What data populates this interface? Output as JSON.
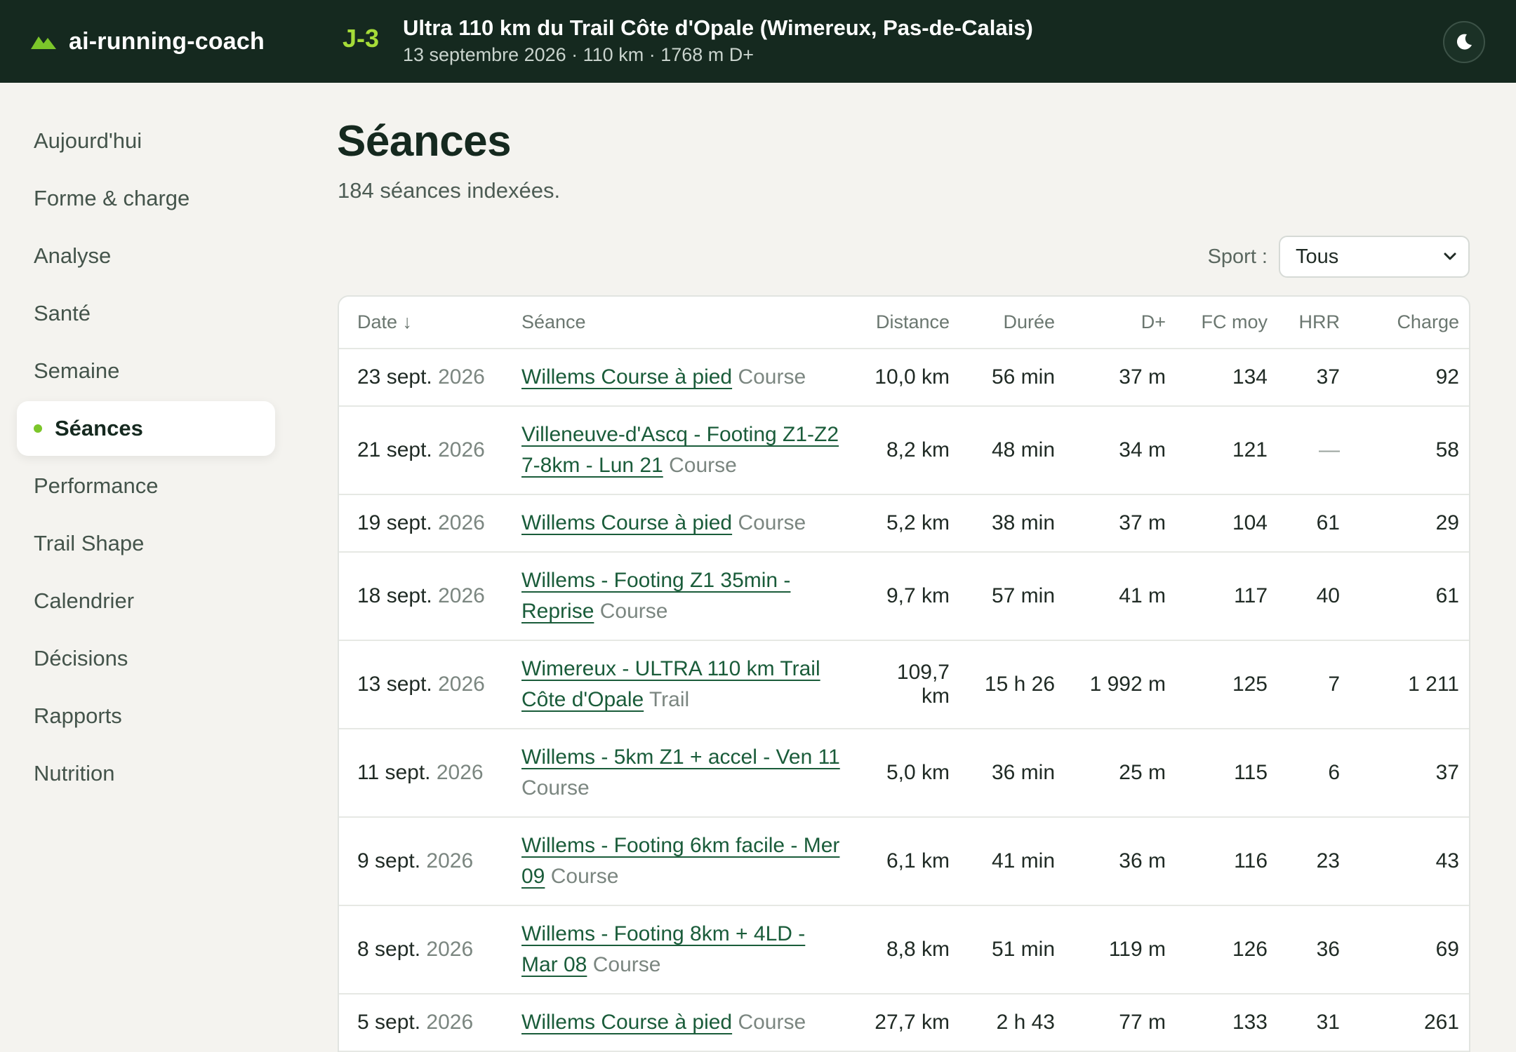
{
  "header": {
    "app_name": "ai-running-coach",
    "countdown": "J-3",
    "race_title": "Ultra 110 km du Trail Côte d'Opale (Wimereux, Pas-de-Calais)",
    "race_meta": "13 septembre 2026 · 110 km · 1768 m D+",
    "theme_icon": "moon-icon"
  },
  "sidebar": {
    "items": [
      {
        "label": "Aujourd'hui"
      },
      {
        "label": "Forme & charge"
      },
      {
        "label": "Analyse"
      },
      {
        "label": "Santé"
      },
      {
        "label": "Semaine"
      },
      {
        "label": "Séances",
        "active": true
      },
      {
        "label": "Performance"
      },
      {
        "label": "Trail Shape"
      },
      {
        "label": "Calendrier"
      },
      {
        "label": "Décisions"
      },
      {
        "label": "Rapports"
      },
      {
        "label": "Nutrition"
      }
    ]
  },
  "main": {
    "title": "Séances",
    "subtitle": "184 séances indexées.",
    "filter_label": "Sport :",
    "filter_value": "Tous"
  },
  "table": {
    "columns": [
      "Date ↓",
      "Séance",
      "Distance",
      "Durée",
      "D+",
      "FC moy",
      "HRR",
      "Charge"
    ],
    "rows": [
      {
        "day": "23 sept.",
        "year": "2026",
        "name": "Willems Course à pied",
        "type": "Course",
        "distance": "10,0 km",
        "duration": "56 min",
        "dplus": "37 m",
        "hr": "134",
        "hrr": "37",
        "load": "92"
      },
      {
        "day": "21 sept.",
        "year": "2026",
        "name": "Villeneuve-d'Ascq - Footing Z1-Z2 7-8km - Lun 21",
        "type": "Course",
        "distance": "8,2 km",
        "duration": "48 min",
        "dplus": "34 m",
        "hr": "121",
        "hrr": "—",
        "load": "58"
      },
      {
        "day": "19 sept.",
        "year": "2026",
        "name": "Willems Course à pied",
        "type": "Course",
        "distance": "5,2 km",
        "duration": "38 min",
        "dplus": "37 m",
        "hr": "104",
        "hrr": "61",
        "load": "29"
      },
      {
        "day": "18 sept.",
        "year": "2026",
        "name": "Willems - Footing Z1 35min - Reprise",
        "type": "Course",
        "distance": "9,7 km",
        "duration": "57 min",
        "dplus": "41 m",
        "hr": "117",
        "hrr": "40",
        "load": "61"
      },
      {
        "day": "13 sept.",
        "year": "2026",
        "name": "Wimereux - ULTRA 110 km Trail Côte d'Opale",
        "type": "Trail",
        "distance": "109,7 km",
        "duration": "15 h 26",
        "dplus": "1 992 m",
        "hr": "125",
        "hrr": "7",
        "load": "1 211"
      },
      {
        "day": "11 sept.",
        "year": "2026",
        "name": "Willems - 5km Z1 + accel - Ven 11",
        "type": "Course",
        "distance": "5,0 km",
        "duration": "36 min",
        "dplus": "25 m",
        "hr": "115",
        "hrr": "6",
        "load": "37"
      },
      {
        "day": "9 sept.",
        "year": "2026",
        "name": "Willems - Footing 6km facile - Mer 09",
        "type": "Course",
        "distance": "6,1 km",
        "duration": "41 min",
        "dplus": "36 m",
        "hr": "116",
        "hrr": "23",
        "load": "43"
      },
      {
        "day": "8 sept.",
        "year": "2026",
        "name": "Willems - Footing 8km + 4LD - Mar 08",
        "type": "Course",
        "distance": "8,8 km",
        "duration": "51 min",
        "dplus": "119 m",
        "hr": "126",
        "hrr": "36",
        "load": "69"
      },
      {
        "day": "5 sept.",
        "year": "2026",
        "name": "Willems Course à pied",
        "type": "Course",
        "distance": "27,7 km",
        "duration": "2 h 43",
        "dplus": "77 m",
        "hr": "133",
        "hrr": "31",
        "load": "261"
      }
    ]
  },
  "colors": {
    "header_bg": "#15291f",
    "accent": "#a6dc38",
    "active_dot": "#7cc62a",
    "link": "#1a5c3a"
  }
}
